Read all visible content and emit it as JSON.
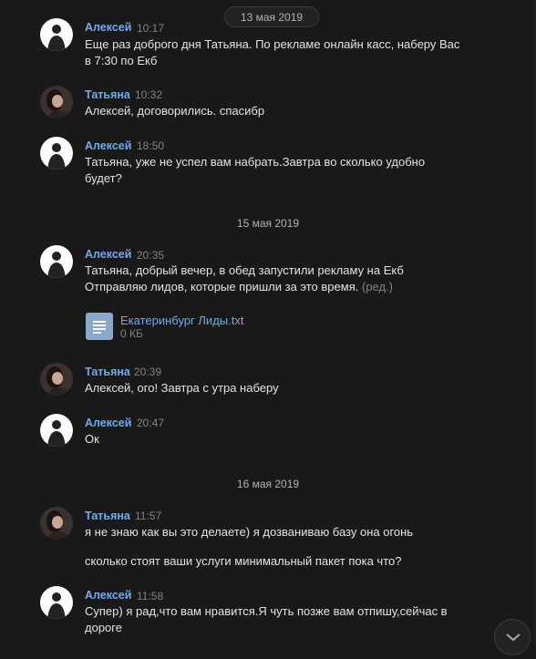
{
  "dates": [
    "13 мая 2019",
    "15 мая 2019",
    "16 мая 2019"
  ],
  "messages": [
    {
      "author": "Алексей",
      "time": "10:17",
      "text": [
        "Еще раз доброго дня Татьяна. По рекламе онлайн касс, наберу Вас",
        "в 7:30 по Екб"
      ]
    },
    {
      "author": "Татьяна",
      "time": "10:32",
      "text": [
        "Алексей, договорились. спасибр"
      ]
    },
    {
      "author": "Алексей",
      "time": "18:50",
      "text": [
        "Татьяна, уже не успел вам набрать.Завтра во сколько удобно",
        "будет?"
      ]
    },
    {
      "author": "Алексей",
      "time": "20:35",
      "text": [
        "Татьяна, добрый вечер, в обед запустили рекламу на Екб",
        "Отправляю лидов, которые пришли за это время."
      ],
      "edited": "(ред.)",
      "attachment": {
        "name": "Екатеринбург Лиды.txt",
        "size": "0 КБ",
        "icon": "document-icon"
      }
    },
    {
      "author": "Татьяна",
      "time": "20:39",
      "text": [
        "Алексей, ого! Завтра с утра наберу"
      ]
    },
    {
      "author": "Алексей",
      "time": "20:47",
      "text": [
        "Ок"
      ]
    },
    {
      "author": "Татьяна",
      "time": "11:57",
      "text": [
        "я не знаю как вы это делаете) я дозваниваю базу она огонь",
        "сколько стоят ваши услуги минимальный пакет пока что?"
      ]
    },
    {
      "author": "Алексей",
      "time": "11:58",
      "text": [
        "Супер) я рад,что вам нравится.Я чуть позже вам отпишу,сейчас в",
        "дороге"
      ]
    }
  ],
  "scroll_button": {
    "icon": "chevron-down-icon"
  },
  "colors": {
    "background": "#19191a",
    "author": "#71aaeb",
    "meta": "#828282",
    "text": "#e1e3e6"
  }
}
